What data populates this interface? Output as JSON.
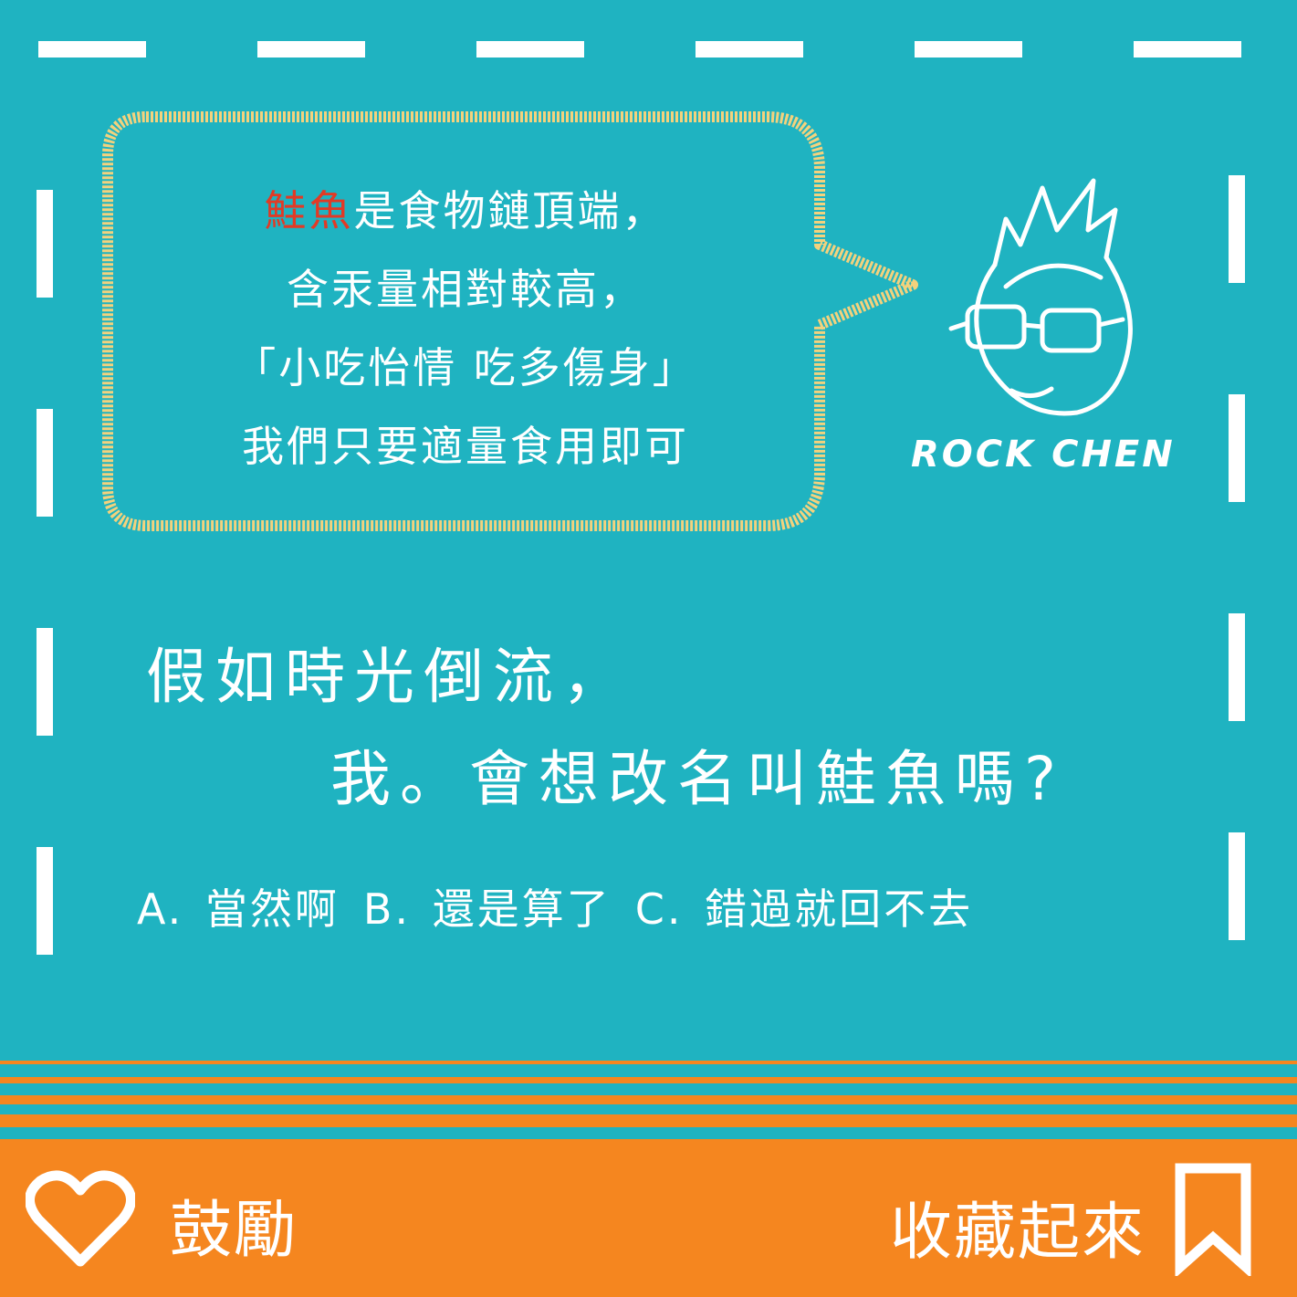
{
  "bubble": {
    "line1_highlight": "鮭魚",
    "line1_rest": "是食物鏈頂端，",
    "line2": "含汞量相對較高，",
    "line3": "「小吃怡情 吃多傷身」",
    "line4": "我們只要適量食用即可"
  },
  "logo": {
    "text": "ROCK CHEN"
  },
  "question": {
    "line1": "假如時光倒流，",
    "line2": "我。會想改名叫鮭魚嗎?"
  },
  "options": [
    {
      "label": "A. 當然啊"
    },
    {
      "label": "B. 還是算了"
    },
    {
      "label": "C. 錯過就回不去"
    }
  ],
  "footer": {
    "like_icon": "heart-icon",
    "like_label": "鼓勵",
    "save_label": "收藏起來",
    "save_icon": "bookmark-icon"
  },
  "colors": {
    "background": "#1fb3c1",
    "footer": "#f5861f",
    "highlight": "#e23a25",
    "bubble_border": "#f3d27d"
  }
}
